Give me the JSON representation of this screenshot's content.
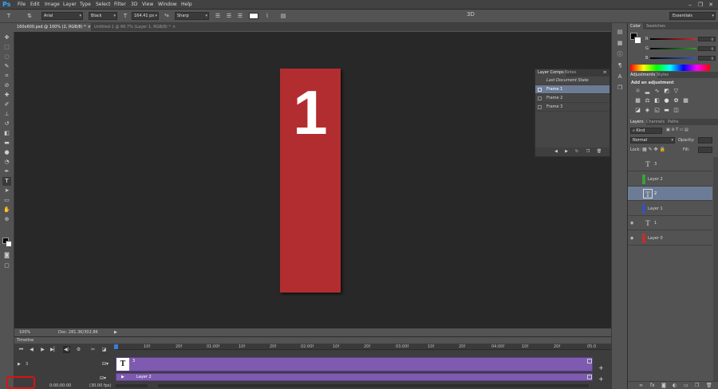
{
  "menubar": {
    "logo": "Ps",
    "items": [
      "File",
      "Edit",
      "Image",
      "Layer",
      "Type",
      "Select",
      "Filter",
      "3D",
      "View",
      "Window",
      "Help"
    ],
    "controls": [
      "‒",
      "❐",
      "✕"
    ]
  },
  "options": {
    "font_family": "Arial",
    "font_style": "Black",
    "font_size": "164.41 px",
    "aa_label": "ªa",
    "antialias": "Sharp",
    "threed": "3D",
    "workspace": "Essentials"
  },
  "tabs": [
    {
      "label": "160x600.psd @ 100% (2, RGB/8) *",
      "active": true
    },
    {
      "label": "Untitled-1 @ 66.7% (Layer 1, RGB/8) *",
      "active": false
    }
  ],
  "canvas": {
    "number": "1",
    "artboard_color": "#b22d30"
  },
  "status": {
    "zoom": "100%",
    "doc": "Doc: 281.3K/302.8K"
  },
  "layer_comps": {
    "tabs": [
      "Layer Comps",
      "Notes"
    ],
    "last_state": "Last Document State",
    "items": [
      "Frame 1",
      "Frame 2",
      "Frame 3"
    ]
  },
  "timeline": {
    "title": "Timeline",
    "ruler": [
      "10f",
      "20f",
      "01:00f",
      "10f",
      "20f",
      "02:00f",
      "10f",
      "20f",
      "03:00f",
      "10f",
      "20f",
      "04:00f",
      "10f",
      "20f",
      "05:0"
    ],
    "tracks": [
      {
        "label": "3",
        "clip": "3"
      },
      {
        "label": "Layer 2",
        "clip": "Layer 2"
      }
    ],
    "current_time": "0:00:00:00",
    "fps": "(30.00 fps)"
  },
  "color_panel": {
    "tabs": [
      "Color",
      "Swatches"
    ],
    "channels": [
      {
        "label": "R",
        "value": "0",
        "color": "#d62a2a"
      },
      {
        "label": "G",
        "value": "0",
        "color": "#2aa02a"
      },
      {
        "label": "B",
        "value": "0",
        "color": "#2a5ad6"
      }
    ]
  },
  "adjustments": {
    "tabs": [
      "Adjustments",
      "Styles"
    ],
    "hint": "Add an adjustment"
  },
  "layers_panel": {
    "tabs": [
      "Layers",
      "Channels",
      "Paths"
    ],
    "kind": "Kind",
    "blend": "Normal",
    "opacity_label": "Opacity:",
    "lock_label": "Lock:",
    "fill_label": "Fill:",
    "layers": [
      {
        "name": "3",
        "type": "text",
        "visible": false,
        "selected": false
      },
      {
        "name": "Layer 2",
        "type": "fill",
        "color": "#3aa03a",
        "visible": false,
        "selected": false
      },
      {
        "name": "2",
        "type": "text",
        "visible": false,
        "selected": true
      },
      {
        "name": "Layer 1",
        "type": "fill",
        "color": "#3a4fb8",
        "visible": false,
        "selected": false
      },
      {
        "name": "1",
        "type": "text",
        "visible": true,
        "selected": false
      },
      {
        "name": "Layer 0",
        "type": "fill",
        "color": "#c03030",
        "visible": true,
        "selected": false
      }
    ]
  }
}
